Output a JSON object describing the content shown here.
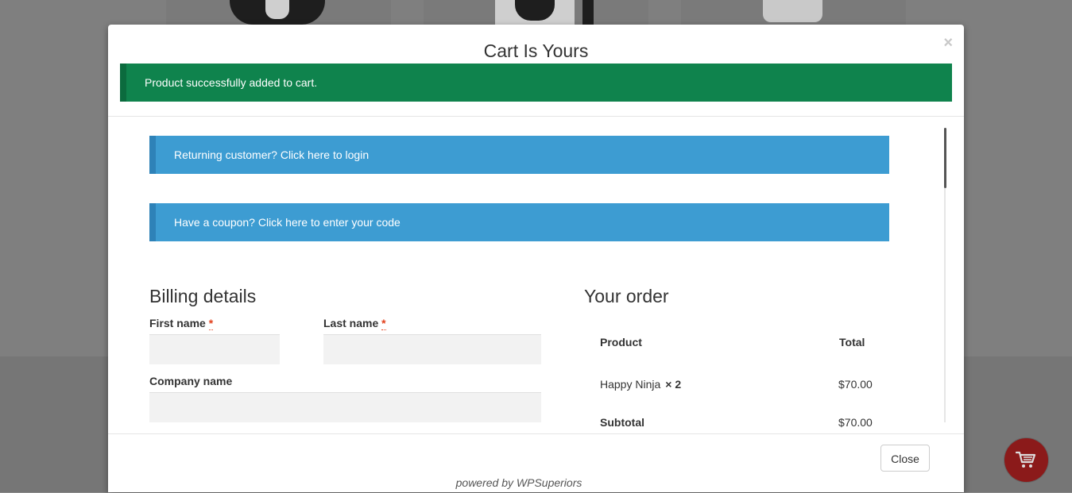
{
  "modal": {
    "title": "Cart Is Yours",
    "close_symbol": "×",
    "success_message": "Product successfully added to cart."
  },
  "notices": {
    "login": "Returning customer? Click here to login",
    "coupon": "Have a coupon? Click here to enter your code"
  },
  "billing": {
    "title": "Billing details",
    "first_name_label": "First name",
    "last_name_label": "Last name",
    "company_label": "Company name",
    "required_mark": "*"
  },
  "order": {
    "title": "Your order",
    "col_product": "Product",
    "col_total": "Total",
    "items": [
      {
        "name": "Happy Ninja",
        "qty": "× 2",
        "total": "$70.00"
      }
    ],
    "subtotal_label": "Subtotal",
    "subtotal_value": "$70.00"
  },
  "footer": {
    "close_label": "Close",
    "powered_by": "powered by WPSuperiors"
  },
  "icons": {
    "cart_fab": "cart-icon"
  },
  "colors": {
    "success": "#0f834d",
    "info": "#3d9cd2",
    "cart_fab": "#8b1a1a"
  }
}
